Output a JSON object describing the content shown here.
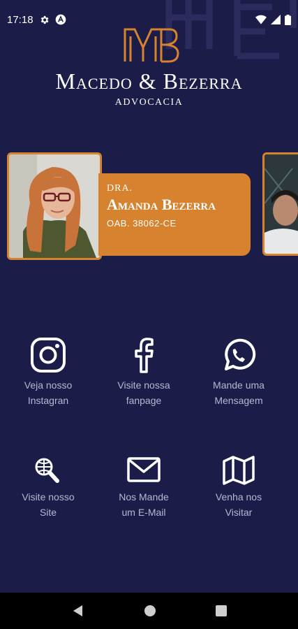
{
  "status_bar": {
    "time": "17:18"
  },
  "header": {
    "firm_name": "Macedo & Bezerra",
    "subtitle": "ADVOCACIA"
  },
  "lawyer_card": {
    "title": "DRA.",
    "name": "Amanda Bezerra",
    "oab": "OAB. 38062-CE"
  },
  "actions": [
    {
      "icon": "instagram-icon",
      "line1": "Veja nosso",
      "line2": "Instagran"
    },
    {
      "icon": "facebook-icon",
      "line1": "Visite nossa",
      "line2": "fanpage"
    },
    {
      "icon": "whatsapp-icon",
      "line1": "Mande uma",
      "line2": "Mensagem"
    },
    {
      "icon": "web-search-icon",
      "line1": "Visite nosso",
      "line2": "Site"
    },
    {
      "icon": "mail-icon",
      "line1": "Nos Mande",
      "line2": "um E-Mail"
    },
    {
      "icon": "map-icon",
      "line1": "Venha nos",
      "line2": "Visitar"
    }
  ],
  "colors": {
    "background": "#1b1c48",
    "accent": "#d6822e",
    "label": "#b7b8d2"
  }
}
